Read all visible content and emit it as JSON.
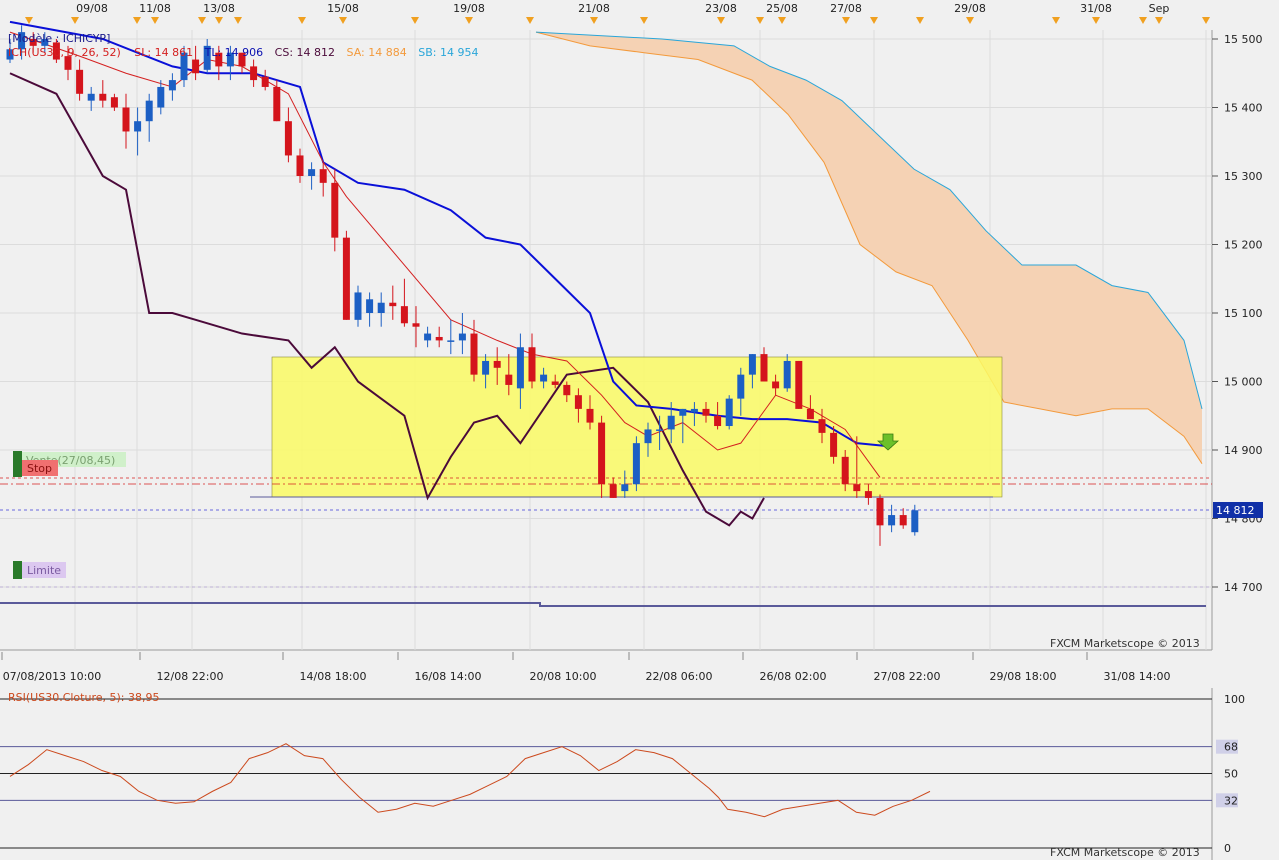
{
  "window": {
    "title": ""
  },
  "colors": {
    "background": "#f0f0f0",
    "up": "#1c5fc4",
    "down": "#d4141c",
    "tenkan": "#d42020",
    "kijun": "#0a10d8",
    "chikou": "#4b0a3a",
    "cloud_fill": "#f5d2b4",
    "senkou_a": "#f39a3c",
    "senkou_b": "#2aa6d9",
    "rsi": "#cc4a1e",
    "highlight": "#fafa64",
    "marker": "#f0a020"
  },
  "top_dates": [
    "09/08",
    "11/08",
    "13/08",
    "15/08",
    "19/08",
    "21/08",
    "23/08",
    "25/08",
    "27/08",
    "29/08",
    "31/08",
    "Sep"
  ],
  "bottom_dates": [
    "07/08/2013 10:00",
    "12/08 22:00",
    "14/08 18:00",
    "16/08 14:00",
    "20/08 10:00",
    "22/08 06:00",
    "26/08 02:00",
    "27/08 22:00",
    "29/08 18:00",
    "31/08 14:00"
  ],
  "legend": {
    "model": "[Modèle : ICHICYP]",
    "ich": "ICH(US30, 9, 26, 52)",
    "sl": "SL: 14 861",
    "tl": "TL: 14 906",
    "cs": "CS: 14 812",
    "sa": "SA: 14 884",
    "sb": "SB: 14 954"
  },
  "orders": {
    "vente": "Vente(27/08,45)",
    "stop": "Stop",
    "limite": "Limite"
  },
  "watermark": "FXCM Marketscope © 2013",
  "rsi_label": "RSI(US30.Cloture, 5): 38,95",
  "price_badge": "14 812",
  "chart_data": {
    "type": "candlestick",
    "instrument": "US30",
    "price_axis": {
      "ticks": [
        15500,
        15400,
        15300,
        15200,
        15100,
        15000,
        14900,
        14800,
        14700
      ],
      "labels": [
        "15 500",
        "15 400",
        "15 300",
        "15 200",
        "15 100",
        "15 000",
        "14 900",
        "14 800",
        "14 700"
      ],
      "range": [
        14660,
        15520
      ]
    },
    "rsi_axis": {
      "levels": [
        100,
        68,
        50,
        32,
        0
      ],
      "labels": [
        "100",
        "68",
        "50",
        "32",
        "0"
      ]
    },
    "candles": [
      [
        15470,
        15500,
        15465,
        15485
      ],
      [
        15485,
        15520,
        15470,
        15510
      ],
      [
        15500,
        15510,
        15480,
        15490
      ],
      [
        15490,
        15510,
        15480,
        15500
      ],
      [
        15495,
        15500,
        15465,
        15470
      ],
      [
        15475,
        15490,
        15440,
        15455
      ],
      [
        15455,
        15470,
        15410,
        15420
      ],
      [
        15410,
        15430,
        15395,
        15420
      ],
      [
        15420,
        15440,
        15400,
        15410
      ],
      [
        15415,
        15420,
        15395,
        15400
      ],
      [
        15400,
        15420,
        15340,
        15365
      ],
      [
        15365,
        15400,
        15330,
        15380
      ],
      [
        15380,
        15420,
        15350,
        15410
      ],
      [
        15400,
        15440,
        15390,
        15430
      ],
      [
        15425,
        15450,
        15410,
        15440
      ],
      [
        15440,
        15490,
        15430,
        15480
      ],
      [
        15470,
        15490,
        15440,
        15450
      ],
      [
        15455,
        15500,
        15450,
        15490
      ],
      [
        15480,
        15490,
        15440,
        15460
      ],
      [
        15460,
        15490,
        15440,
        15480
      ],
      [
        15480,
        15480,
        15450,
        15460
      ],
      [
        15460,
        15470,
        15430,
        15440
      ],
      [
        15445,
        15455,
        15425,
        15430
      ],
      [
        15430,
        15440,
        15380,
        15380
      ],
      [
        15380,
        15400,
        15320,
        15330
      ],
      [
        15330,
        15340,
        15290,
        15300
      ],
      [
        15300,
        15320,
        15280,
        15310
      ],
      [
        15310,
        15320,
        15270,
        15290
      ],
      [
        15290,
        15310,
        15190,
        15210
      ],
      [
        15210,
        15220,
        15090,
        15090
      ],
      [
        15090,
        15140,
        15080,
        15130
      ],
      [
        15100,
        15130,
        15080,
        15120
      ],
      [
        15100,
        15130,
        15080,
        15115
      ],
      [
        15115,
        15140,
        15090,
        15110
      ],
      [
        15110,
        15150,
        15080,
        15085
      ],
      [
        15085,
        15110,
        15050,
        15080
      ],
      [
        15060,
        15080,
        15050,
        15070
      ],
      [
        15065,
        15080,
        15050,
        15060
      ],
      [
        15060,
        15090,
        15040,
        15060
      ],
      [
        15060,
        15100,
        15040,
        15070
      ],
      [
        15070,
        15090,
        15000,
        15010
      ],
      [
        15010,
        15040,
        14990,
        15030
      ],
      [
        15030,
        15050,
        14995,
        15020
      ],
      [
        15010,
        15040,
        14980,
        14995
      ],
      [
        14990,
        15070,
        14960,
        15050
      ],
      [
        15050,
        15070,
        14990,
        15000
      ],
      [
        15000,
        15020,
        14990,
        15010
      ],
      [
        15000,
        15010,
        14990,
        14995
      ],
      [
        14995,
        15000,
        14970,
        14980
      ],
      [
        14980,
        14990,
        14940,
        14960
      ],
      [
        14960,
        14980,
        14930,
        14940
      ],
      [
        14940,
        14950,
        14830,
        14850
      ],
      [
        14850,
        14860,
        14830,
        14830
      ],
      [
        14840,
        14870,
        14830,
        14850
      ],
      [
        14850,
        14920,
        14840,
        14910
      ],
      [
        14910,
        14940,
        14890,
        14930
      ],
      [
        14930,
        14950,
        14900,
        14930
      ],
      [
        14930,
        14970,
        14910,
        14950
      ],
      [
        14950,
        14960,
        14910,
        14960
      ],
      [
        14955,
        14970,
        14935,
        14960
      ],
      [
        14960,
        14970,
        14940,
        14950
      ],
      [
        14950,
        14970,
        14930,
        14935
      ],
      [
        14935,
        14980,
        14930,
        14975
      ],
      [
        14975,
        15020,
        14950,
        15010
      ],
      [
        15010,
        15040,
        14990,
        15040
      ],
      [
        15040,
        15050,
        15000,
        15000
      ],
      [
        15000,
        15010,
        14980,
        14990
      ],
      [
        14990,
        15040,
        14985,
        15030
      ],
      [
        15030,
        15030,
        14960,
        14960
      ],
      [
        14960,
        14980,
        14950,
        14945
      ],
      [
        14945,
        14960,
        14910,
        14925
      ],
      [
        14925,
        14935,
        14880,
        14890
      ],
      [
        14890,
        14900,
        14840,
        14850
      ],
      [
        14850,
        14920,
        14830,
        14840
      ],
      [
        14840,
        14850,
        14820,
        14830
      ],
      [
        14830,
        14835,
        14760,
        14790
      ],
      [
        14790,
        14820,
        14780,
        14805
      ],
      [
        14805,
        14815,
        14785,
        14790
      ],
      [
        14780,
        14820,
        14775,
        14812
      ]
    ],
    "tenkan": [
      [
        0,
        15510
      ],
      [
        6,
        15475
      ],
      [
        10,
        15450
      ],
      [
        14,
        15430
      ],
      [
        17,
        15470
      ],
      [
        20,
        15460
      ],
      [
        24,
        15420
      ],
      [
        27,
        15320
      ],
      [
        29,
        15270
      ],
      [
        31,
        15230
      ],
      [
        34,
        15170
      ],
      [
        38,
        15090
      ],
      [
        42,
        15060
      ],
      [
        45,
        15040
      ],
      [
        48,
        15030
      ],
      [
        51,
        14980
      ],
      [
        53,
        14940
      ],
      [
        55,
        14920
      ],
      [
        58,
        14940
      ],
      [
        61,
        14900
      ],
      [
        63,
        14910
      ],
      [
        66,
        14980
      ],
      [
        69,
        14960
      ],
      [
        72,
        14930
      ],
      [
        75,
        14860
      ]
    ],
    "kijun": [
      [
        0,
        15525
      ],
      [
        8,
        15500
      ],
      [
        14,
        15460
      ],
      [
        17,
        15450
      ],
      [
        21,
        15450
      ],
      [
        25,
        15430
      ],
      [
        27,
        15320
      ],
      [
        30,
        15290
      ],
      [
        34,
        15280
      ],
      [
        38,
        15250
      ],
      [
        41,
        15210
      ],
      [
        44,
        15200
      ],
      [
        47,
        15150
      ],
      [
        50,
        15100
      ],
      [
        52,
        15000
      ],
      [
        54,
        14965
      ],
      [
        57,
        14960
      ],
      [
        61,
        14950
      ],
      [
        64,
        14945
      ],
      [
        67,
        14945
      ],
      [
        70,
        14940
      ],
      [
        72,
        14920
      ],
      [
        73,
        14910
      ],
      [
        76,
        14905
      ]
    ],
    "chikou": [
      [
        0,
        15450
      ],
      [
        4,
        15420
      ],
      [
        8,
        15300
      ],
      [
        10,
        15280
      ],
      [
        12,
        15100
      ],
      [
        14,
        15100
      ],
      [
        16,
        15090
      ],
      [
        20,
        15070
      ],
      [
        24,
        15060
      ],
      [
        26,
        15020
      ],
      [
        28,
        15050
      ],
      [
        30,
        15000
      ],
      [
        34,
        14950
      ],
      [
        36,
        14830
      ],
      [
        38,
        14890
      ],
      [
        40,
        14940
      ],
      [
        42,
        14950
      ],
      [
        44,
        14910
      ],
      [
        48,
        15010
      ],
      [
        52,
        15020
      ],
      [
        55,
        14970
      ],
      [
        58,
        14870
      ],
      [
        60,
        14810
      ],
      [
        62,
        14790
      ],
      [
        63,
        14810
      ],
      [
        64,
        14800
      ],
      [
        65,
        14830
      ]
    ],
    "senkou_a": [
      [
        26,
        15510
      ],
      [
        32,
        15490
      ],
      [
        38,
        15480
      ],
      [
        44,
        15470
      ],
      [
        50,
        15440
      ],
      [
        54,
        15390
      ],
      [
        58,
        15320
      ],
      [
        62,
        15200
      ],
      [
        66,
        15160
      ],
      [
        70,
        15140
      ],
      [
        74,
        15060
      ],
      [
        78,
        14970
      ],
      [
        82,
        14960
      ],
      [
        86,
        14950
      ],
      [
        90,
        14960
      ],
      [
        94,
        14960
      ],
      [
        98,
        14920
      ],
      [
        100,
        14880
      ]
    ],
    "senkou_b": [
      [
        26,
        15510
      ],
      [
        40,
        15500
      ],
      [
        48,
        15490
      ],
      [
        52,
        15460
      ],
      [
        56,
        15440
      ],
      [
        60,
        15410
      ],
      [
        64,
        15360
      ],
      [
        68,
        15310
      ],
      [
        72,
        15280
      ],
      [
        76,
        15220
      ],
      [
        80,
        15170
      ],
      [
        86,
        15170
      ],
      [
        90,
        15140
      ],
      [
        94,
        15130
      ],
      [
        98,
        15060
      ],
      [
        100,
        14960
      ]
    ],
    "rsi": [
      [
        0,
        48
      ],
      [
        2,
        56
      ],
      [
        4,
        66
      ],
      [
        6,
        62
      ],
      [
        8,
        58
      ],
      [
        10,
        52
      ],
      [
        12,
        48
      ],
      [
        14,
        38
      ],
      [
        16,
        32
      ],
      [
        18,
        30
      ],
      [
        20,
        31
      ],
      [
        22,
        38
      ],
      [
        24,
        44
      ],
      [
        26,
        60
      ],
      [
        28,
        64
      ],
      [
        30,
        70
      ],
      [
        32,
        62
      ],
      [
        34,
        60
      ],
      [
        36,
        46
      ],
      [
        38,
        34
      ],
      [
        40,
        24
      ],
      [
        42,
        26
      ],
      [
        44,
        30
      ],
      [
        46,
        28
      ],
      [
        48,
        32
      ],
      [
        50,
        36
      ],
      [
        52,
        42
      ],
      [
        54,
        48
      ],
      [
        56,
        60
      ],
      [
        58,
        64
      ],
      [
        60,
        68
      ],
      [
        62,
        62
      ],
      [
        64,
        52
      ],
      [
        66,
        58
      ],
      [
        68,
        66
      ],
      [
        70,
        64
      ],
      [
        72,
        60
      ],
      [
        74,
        50
      ],
      [
        76,
        40
      ],
      [
        77,
        34
      ],
      [
        78,
        26
      ],
      [
        80,
        24
      ],
      [
        82,
        21
      ],
      [
        84,
        26
      ],
      [
        86,
        28
      ],
      [
        88,
        30
      ],
      [
        90,
        32
      ],
      [
        92,
        24
      ],
      [
        94,
        22
      ],
      [
        96,
        28
      ],
      [
        98,
        32
      ],
      [
        100,
        38
      ]
    ]
  }
}
